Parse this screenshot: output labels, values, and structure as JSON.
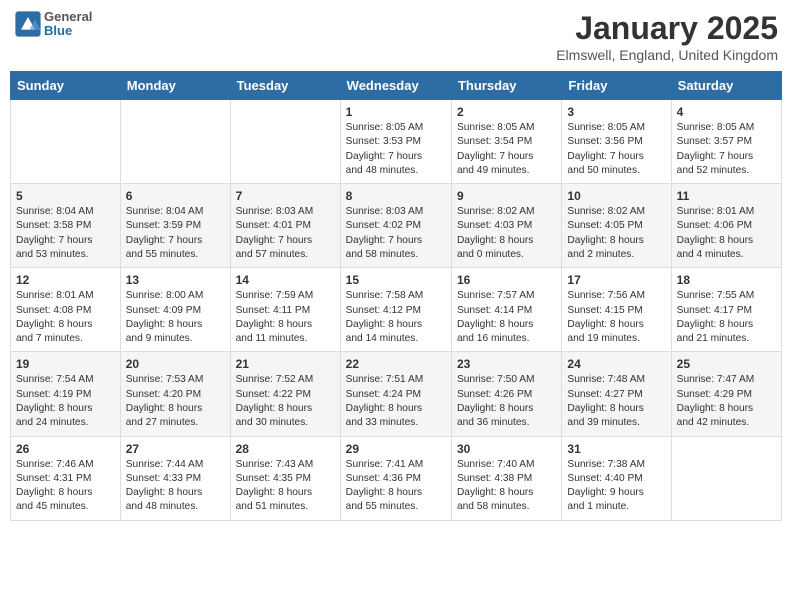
{
  "header": {
    "logo_general": "General",
    "logo_blue": "Blue",
    "month_title": "January 2025",
    "location": "Elmswell, England, United Kingdom"
  },
  "weekdays": [
    "Sunday",
    "Monday",
    "Tuesday",
    "Wednesday",
    "Thursday",
    "Friday",
    "Saturday"
  ],
  "weeks": [
    [
      {
        "day": "",
        "info": ""
      },
      {
        "day": "",
        "info": ""
      },
      {
        "day": "",
        "info": ""
      },
      {
        "day": "1",
        "info": "Sunrise: 8:05 AM\nSunset: 3:53 PM\nDaylight: 7 hours\nand 48 minutes."
      },
      {
        "day": "2",
        "info": "Sunrise: 8:05 AM\nSunset: 3:54 PM\nDaylight: 7 hours\nand 49 minutes."
      },
      {
        "day": "3",
        "info": "Sunrise: 8:05 AM\nSunset: 3:56 PM\nDaylight: 7 hours\nand 50 minutes."
      },
      {
        "day": "4",
        "info": "Sunrise: 8:05 AM\nSunset: 3:57 PM\nDaylight: 7 hours\nand 52 minutes."
      }
    ],
    [
      {
        "day": "5",
        "info": "Sunrise: 8:04 AM\nSunset: 3:58 PM\nDaylight: 7 hours\nand 53 minutes."
      },
      {
        "day": "6",
        "info": "Sunrise: 8:04 AM\nSunset: 3:59 PM\nDaylight: 7 hours\nand 55 minutes."
      },
      {
        "day": "7",
        "info": "Sunrise: 8:03 AM\nSunset: 4:01 PM\nDaylight: 7 hours\nand 57 minutes."
      },
      {
        "day": "8",
        "info": "Sunrise: 8:03 AM\nSunset: 4:02 PM\nDaylight: 7 hours\nand 58 minutes."
      },
      {
        "day": "9",
        "info": "Sunrise: 8:02 AM\nSunset: 4:03 PM\nDaylight: 8 hours\nand 0 minutes."
      },
      {
        "day": "10",
        "info": "Sunrise: 8:02 AM\nSunset: 4:05 PM\nDaylight: 8 hours\nand 2 minutes."
      },
      {
        "day": "11",
        "info": "Sunrise: 8:01 AM\nSunset: 4:06 PM\nDaylight: 8 hours\nand 4 minutes."
      }
    ],
    [
      {
        "day": "12",
        "info": "Sunrise: 8:01 AM\nSunset: 4:08 PM\nDaylight: 8 hours\nand 7 minutes."
      },
      {
        "day": "13",
        "info": "Sunrise: 8:00 AM\nSunset: 4:09 PM\nDaylight: 8 hours\nand 9 minutes."
      },
      {
        "day": "14",
        "info": "Sunrise: 7:59 AM\nSunset: 4:11 PM\nDaylight: 8 hours\nand 11 minutes."
      },
      {
        "day": "15",
        "info": "Sunrise: 7:58 AM\nSunset: 4:12 PM\nDaylight: 8 hours\nand 14 minutes."
      },
      {
        "day": "16",
        "info": "Sunrise: 7:57 AM\nSunset: 4:14 PM\nDaylight: 8 hours\nand 16 minutes."
      },
      {
        "day": "17",
        "info": "Sunrise: 7:56 AM\nSunset: 4:15 PM\nDaylight: 8 hours\nand 19 minutes."
      },
      {
        "day": "18",
        "info": "Sunrise: 7:55 AM\nSunset: 4:17 PM\nDaylight: 8 hours\nand 21 minutes."
      }
    ],
    [
      {
        "day": "19",
        "info": "Sunrise: 7:54 AM\nSunset: 4:19 PM\nDaylight: 8 hours\nand 24 minutes."
      },
      {
        "day": "20",
        "info": "Sunrise: 7:53 AM\nSunset: 4:20 PM\nDaylight: 8 hours\nand 27 minutes."
      },
      {
        "day": "21",
        "info": "Sunrise: 7:52 AM\nSunset: 4:22 PM\nDaylight: 8 hours\nand 30 minutes."
      },
      {
        "day": "22",
        "info": "Sunrise: 7:51 AM\nSunset: 4:24 PM\nDaylight: 8 hours\nand 33 minutes."
      },
      {
        "day": "23",
        "info": "Sunrise: 7:50 AM\nSunset: 4:26 PM\nDaylight: 8 hours\nand 36 minutes."
      },
      {
        "day": "24",
        "info": "Sunrise: 7:48 AM\nSunset: 4:27 PM\nDaylight: 8 hours\nand 39 minutes."
      },
      {
        "day": "25",
        "info": "Sunrise: 7:47 AM\nSunset: 4:29 PM\nDaylight: 8 hours\nand 42 minutes."
      }
    ],
    [
      {
        "day": "26",
        "info": "Sunrise: 7:46 AM\nSunset: 4:31 PM\nDaylight: 8 hours\nand 45 minutes."
      },
      {
        "day": "27",
        "info": "Sunrise: 7:44 AM\nSunset: 4:33 PM\nDaylight: 8 hours\nand 48 minutes."
      },
      {
        "day": "28",
        "info": "Sunrise: 7:43 AM\nSunset: 4:35 PM\nDaylight: 8 hours\nand 51 minutes."
      },
      {
        "day": "29",
        "info": "Sunrise: 7:41 AM\nSunset: 4:36 PM\nDaylight: 8 hours\nand 55 minutes."
      },
      {
        "day": "30",
        "info": "Sunrise: 7:40 AM\nSunset: 4:38 PM\nDaylight: 8 hours\nand 58 minutes."
      },
      {
        "day": "31",
        "info": "Sunrise: 7:38 AM\nSunset: 4:40 PM\nDaylight: 9 hours\nand 1 minute."
      },
      {
        "day": "",
        "info": ""
      }
    ]
  ]
}
